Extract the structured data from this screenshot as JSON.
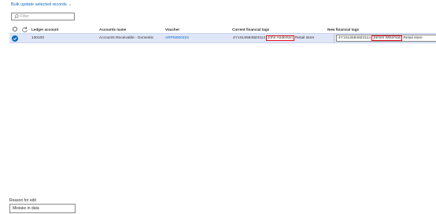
{
  "toolbar": {
    "bulk_update_label": "Bulk update selected records",
    "chevron_icon": "chevron-down-icon"
  },
  "filter": {
    "placeholder": "Filter",
    "icon": "search-icon"
  },
  "grid": {
    "columns": {
      "ledger_account": "Ledger account",
      "account_name": "Accounts name",
      "voucher": "Voucher",
      "current_tags": "Current financial tags",
      "new_tags": "New financial tags"
    },
    "rows": [
      {
        "ledger_account": "130100",
        "account_name": "Accounts Receivable - Domestic",
        "voucher": "ARPM000224",
        "current_tags": {
          "code": "4Y1SL65848Z4114",
          "person": "John Anderson",
          "store": "Retail store"
        },
        "new_tags": {
          "code": "4Y1SL65848Z4114",
          "person": "James Wiseman",
          "store": "Retail store"
        },
        "selected": true
      }
    ]
  },
  "reason": {
    "label": "Reason for edit",
    "value": "Mistake in data"
  },
  "colors": {
    "accent": "#0f6cbd",
    "highlight_border": "#e81123",
    "selected_row": "#dfe6f7"
  }
}
